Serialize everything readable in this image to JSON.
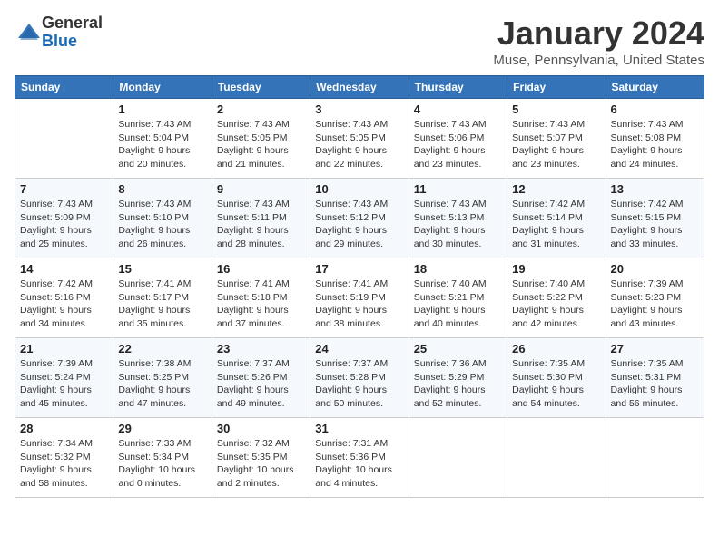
{
  "logo": {
    "general": "General",
    "blue": "Blue"
  },
  "title": "January 2024",
  "location": "Muse, Pennsylvania, United States",
  "days_of_week": [
    "Sunday",
    "Monday",
    "Tuesday",
    "Wednesday",
    "Thursday",
    "Friday",
    "Saturday"
  ],
  "weeks": [
    [
      {
        "day": "",
        "info": ""
      },
      {
        "day": "1",
        "info": "Sunrise: 7:43 AM\nSunset: 5:04 PM\nDaylight: 9 hours\nand 20 minutes."
      },
      {
        "day": "2",
        "info": "Sunrise: 7:43 AM\nSunset: 5:05 PM\nDaylight: 9 hours\nand 21 minutes."
      },
      {
        "day": "3",
        "info": "Sunrise: 7:43 AM\nSunset: 5:05 PM\nDaylight: 9 hours\nand 22 minutes."
      },
      {
        "day": "4",
        "info": "Sunrise: 7:43 AM\nSunset: 5:06 PM\nDaylight: 9 hours\nand 23 minutes."
      },
      {
        "day": "5",
        "info": "Sunrise: 7:43 AM\nSunset: 5:07 PM\nDaylight: 9 hours\nand 23 minutes."
      },
      {
        "day": "6",
        "info": "Sunrise: 7:43 AM\nSunset: 5:08 PM\nDaylight: 9 hours\nand 24 minutes."
      }
    ],
    [
      {
        "day": "7",
        "info": "Sunrise: 7:43 AM\nSunset: 5:09 PM\nDaylight: 9 hours\nand 25 minutes."
      },
      {
        "day": "8",
        "info": "Sunrise: 7:43 AM\nSunset: 5:10 PM\nDaylight: 9 hours\nand 26 minutes."
      },
      {
        "day": "9",
        "info": "Sunrise: 7:43 AM\nSunset: 5:11 PM\nDaylight: 9 hours\nand 28 minutes."
      },
      {
        "day": "10",
        "info": "Sunrise: 7:43 AM\nSunset: 5:12 PM\nDaylight: 9 hours\nand 29 minutes."
      },
      {
        "day": "11",
        "info": "Sunrise: 7:43 AM\nSunset: 5:13 PM\nDaylight: 9 hours\nand 30 minutes."
      },
      {
        "day": "12",
        "info": "Sunrise: 7:42 AM\nSunset: 5:14 PM\nDaylight: 9 hours\nand 31 minutes."
      },
      {
        "day": "13",
        "info": "Sunrise: 7:42 AM\nSunset: 5:15 PM\nDaylight: 9 hours\nand 33 minutes."
      }
    ],
    [
      {
        "day": "14",
        "info": "Sunrise: 7:42 AM\nSunset: 5:16 PM\nDaylight: 9 hours\nand 34 minutes."
      },
      {
        "day": "15",
        "info": "Sunrise: 7:41 AM\nSunset: 5:17 PM\nDaylight: 9 hours\nand 35 minutes."
      },
      {
        "day": "16",
        "info": "Sunrise: 7:41 AM\nSunset: 5:18 PM\nDaylight: 9 hours\nand 37 minutes."
      },
      {
        "day": "17",
        "info": "Sunrise: 7:41 AM\nSunset: 5:19 PM\nDaylight: 9 hours\nand 38 minutes."
      },
      {
        "day": "18",
        "info": "Sunrise: 7:40 AM\nSunset: 5:21 PM\nDaylight: 9 hours\nand 40 minutes."
      },
      {
        "day": "19",
        "info": "Sunrise: 7:40 AM\nSunset: 5:22 PM\nDaylight: 9 hours\nand 42 minutes."
      },
      {
        "day": "20",
        "info": "Sunrise: 7:39 AM\nSunset: 5:23 PM\nDaylight: 9 hours\nand 43 minutes."
      }
    ],
    [
      {
        "day": "21",
        "info": "Sunrise: 7:39 AM\nSunset: 5:24 PM\nDaylight: 9 hours\nand 45 minutes."
      },
      {
        "day": "22",
        "info": "Sunrise: 7:38 AM\nSunset: 5:25 PM\nDaylight: 9 hours\nand 47 minutes."
      },
      {
        "day": "23",
        "info": "Sunrise: 7:37 AM\nSunset: 5:26 PM\nDaylight: 9 hours\nand 49 minutes."
      },
      {
        "day": "24",
        "info": "Sunrise: 7:37 AM\nSunset: 5:28 PM\nDaylight: 9 hours\nand 50 minutes."
      },
      {
        "day": "25",
        "info": "Sunrise: 7:36 AM\nSunset: 5:29 PM\nDaylight: 9 hours\nand 52 minutes."
      },
      {
        "day": "26",
        "info": "Sunrise: 7:35 AM\nSunset: 5:30 PM\nDaylight: 9 hours\nand 54 minutes."
      },
      {
        "day": "27",
        "info": "Sunrise: 7:35 AM\nSunset: 5:31 PM\nDaylight: 9 hours\nand 56 minutes."
      }
    ],
    [
      {
        "day": "28",
        "info": "Sunrise: 7:34 AM\nSunset: 5:32 PM\nDaylight: 9 hours\nand 58 minutes."
      },
      {
        "day": "29",
        "info": "Sunrise: 7:33 AM\nSunset: 5:34 PM\nDaylight: 10 hours\nand 0 minutes."
      },
      {
        "day": "30",
        "info": "Sunrise: 7:32 AM\nSunset: 5:35 PM\nDaylight: 10 hours\nand 2 minutes."
      },
      {
        "day": "31",
        "info": "Sunrise: 7:31 AM\nSunset: 5:36 PM\nDaylight: 10 hours\nand 4 minutes."
      },
      {
        "day": "",
        "info": ""
      },
      {
        "day": "",
        "info": ""
      },
      {
        "day": "",
        "info": ""
      }
    ]
  ]
}
